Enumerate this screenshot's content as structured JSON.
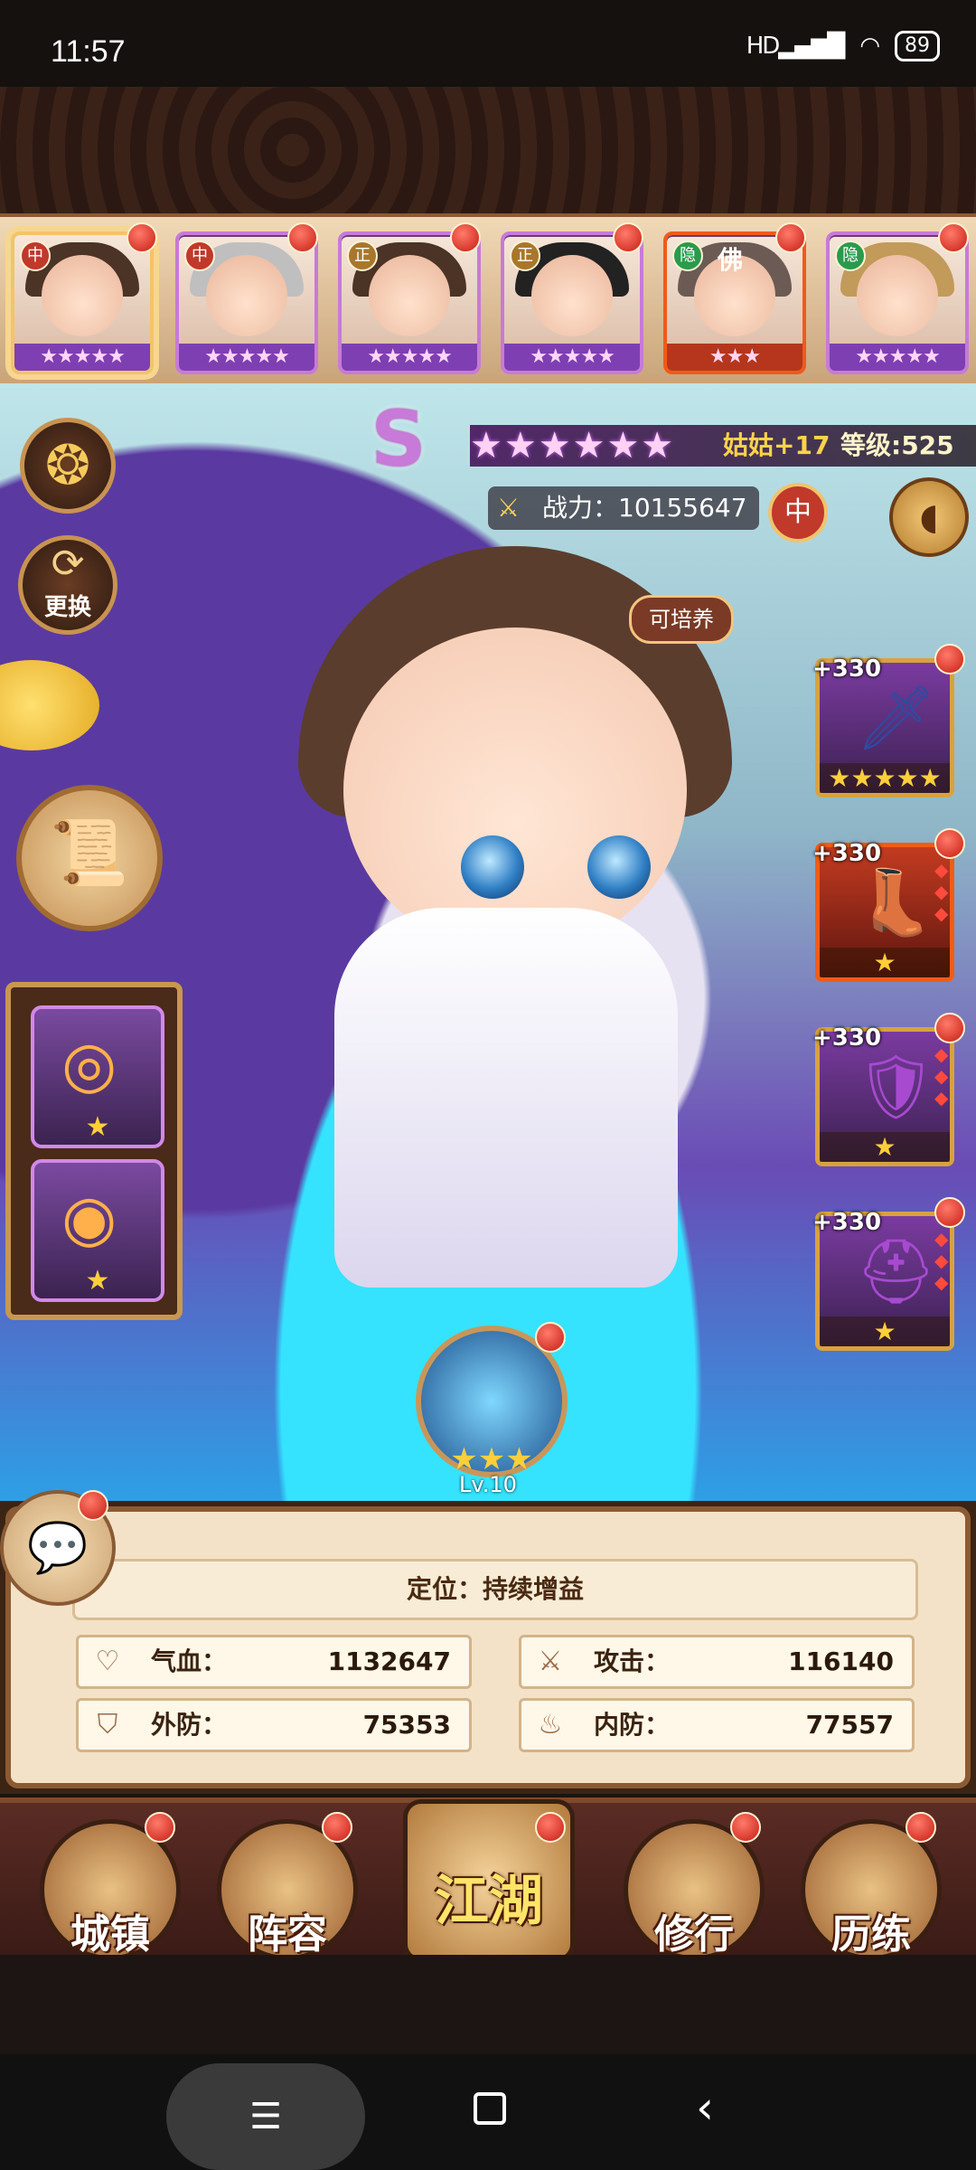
{
  "status_bar": {
    "time": "11:57",
    "signal": "HD",
    "battery": "89"
  },
  "roster": [
    {
      "faction": "中",
      "faction_color": "#c0392b",
      "stars": "★★★★★"
    },
    {
      "faction": "中",
      "faction_color": "#c0392b",
      "stars": "★★★★★"
    },
    {
      "faction": "正",
      "faction_color": "#a8772b",
      "stars": "★★★★★"
    },
    {
      "faction": "正",
      "faction_color": "#a8772b",
      "stars": "★★★★★"
    },
    {
      "faction": "隐",
      "faction_color": "#2b9a4c",
      "stars": "★★★",
      "badge": "佛"
    },
    {
      "faction": "隐",
      "faction_color": "#2b9a4c",
      "stars": "★★★★★"
    }
  ],
  "hero": {
    "grade": "S",
    "stars": "★★★★★★",
    "name": "姑姑+17",
    "level": "等级:525",
    "power_label": "战力：10155647",
    "faction": "中",
    "trainable": "可培养"
  },
  "left_buttons": {
    "switch_label": "更换"
  },
  "equipment": [
    {
      "plus": "+330",
      "stars": "★★★★★"
    },
    {
      "plus": "+330",
      "stars": "★"
    },
    {
      "plus": "+330",
      "stars": "★"
    },
    {
      "plus": "+330",
      "stars": "★"
    }
  ],
  "treasures": [
    {
      "stars": "★"
    },
    {
      "stars": "★"
    }
  ],
  "skill": {
    "stars": "★★★",
    "level": "Lv.10"
  },
  "stats": {
    "role": "定位：持续增益",
    "hp_label": "气血：",
    "hp_value": "1132647",
    "atk_label": "攻击：",
    "atk_value": "116140",
    "def_label": "外防：",
    "def_value": "75353",
    "mdef_label": "内防：",
    "mdef_value": "77557"
  },
  "bottom_nav": [
    {
      "label": "城镇"
    },
    {
      "label": "阵容"
    },
    {
      "label": "江湖"
    },
    {
      "label": "修行"
    },
    {
      "label": "历练"
    }
  ]
}
